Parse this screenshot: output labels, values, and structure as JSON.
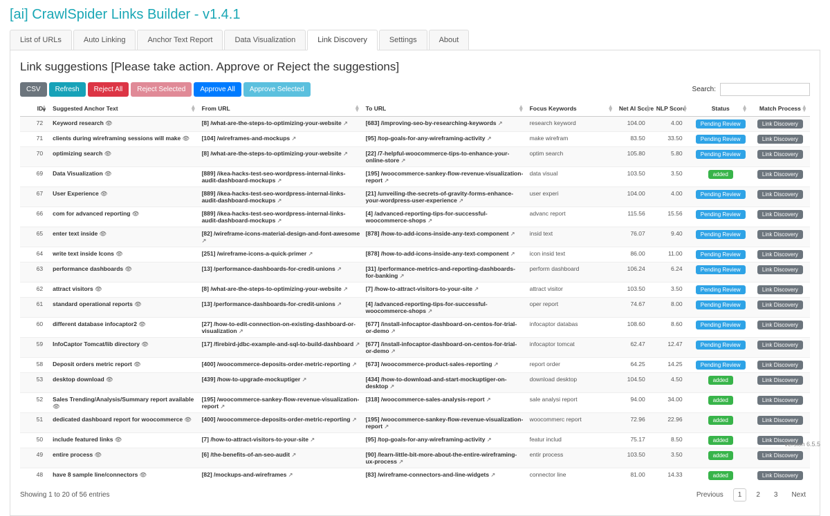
{
  "app_title": "[ai] CrawlSpider Links Builder - v1.4.1",
  "tabs": [
    {
      "label": "List of URLs"
    },
    {
      "label": "Auto Linking"
    },
    {
      "label": "Anchor Text Report"
    },
    {
      "label": "Data Visualization"
    },
    {
      "label": "Link Discovery",
      "active": true
    },
    {
      "label": "Settings"
    },
    {
      "label": "About"
    }
  ],
  "panel": {
    "heading": "Link suggestions [Please take action. Approve or Reject the suggestions]",
    "buttons": {
      "csv": "CSV",
      "refresh": "Refresh",
      "reject_all": "Reject All",
      "reject_selected": "Reject Selected",
      "approve_all": "Approve All",
      "approve_selected": "Approve Selected"
    },
    "search_label": "Search:",
    "columns": {
      "id": "ID",
      "anchor": "Suggested Anchor Text",
      "from": "From URL",
      "to": "To URL",
      "focus": "Focus Keywords",
      "net": "Net AI Score",
      "nlp": "NLP Score",
      "status": "Status",
      "match": "Match Process"
    },
    "status_labels": {
      "pending": "Pending Review",
      "added": "added"
    },
    "match_label": "Link Discovery",
    "rows": [
      {
        "id": 72,
        "anchor": "Keyword research",
        "from_n": 8,
        "from": "/what-are-the-steps-to-optimizing-your-website",
        "to_n": 683,
        "to": "/improving-seo-by-researching-keywords",
        "kw": "research keyword",
        "net": "104.00",
        "nlp": "4.00",
        "status": "pending"
      },
      {
        "id": 71,
        "anchor": "clients during wireframing sessions will make",
        "from_n": 104,
        "from": "/wireframes-and-mockups",
        "to_n": 95,
        "to": "/top-goals-for-any-wireframing-activity",
        "kw": "make wirefram",
        "net": "83.50",
        "nlp": "33.50",
        "status": "pending"
      },
      {
        "id": 70,
        "anchor": "optimizing search",
        "from_n": 8,
        "from": "/what-are-the-steps-to-optimizing-your-website",
        "to_n": 22,
        "to": "/7-helpful-woocommerce-tips-to-enhance-your-online-store",
        "kw": "optim search",
        "net": "105.80",
        "nlp": "5.80",
        "status": "pending"
      },
      {
        "id": 69,
        "anchor": "Data Visualization",
        "from_n": 889,
        "from": "/ikea-hacks-test-seo-wordpress-internal-links-audit-dashboard-mockups",
        "to_n": 195,
        "to": "/woocommerce-sankey-flow-revenue-visualization-report",
        "kw": "data visual",
        "net": "103.50",
        "nlp": "3.50",
        "status": "added"
      },
      {
        "id": 67,
        "anchor": "User Experience",
        "from_n": 889,
        "from": "/ikea-hacks-test-seo-wordpress-internal-links-audit-dashboard-mockups",
        "to_n": 21,
        "to": "/unveiling-the-secrets-of-gravity-forms-enhance-your-wordpress-user-experience",
        "kw": "user experi",
        "net": "104.00",
        "nlp": "4.00",
        "status": "pending"
      },
      {
        "id": 66,
        "anchor": "com for advanced reporting",
        "from_n": 889,
        "from": "/ikea-hacks-test-seo-wordpress-internal-links-audit-dashboard-mockups",
        "to_n": 4,
        "to": "/advanced-reporting-tips-for-successful-woocommerce-shops",
        "kw": "advanc report",
        "net": "115.56",
        "nlp": "15.56",
        "status": "pending"
      },
      {
        "id": 65,
        "anchor": "enter text inside",
        "from_n": 82,
        "from": "/wireframe-icons-material-design-and-font-awesome",
        "to_n": 878,
        "to": "/how-to-add-icons-inside-any-text-component",
        "kw": "insid text",
        "net": "76.07",
        "nlp": "9.40",
        "status": "pending"
      },
      {
        "id": 64,
        "anchor": "write text inside Icons",
        "from_n": 251,
        "from": "/wireframe-icons-a-quick-primer",
        "to_n": 878,
        "to": "/how-to-add-icons-inside-any-text-component",
        "kw": "icon insid text",
        "net": "86.00",
        "nlp": "11.00",
        "status": "pending"
      },
      {
        "id": 63,
        "anchor": "performance dashboards",
        "from_n": 13,
        "from": "/performance-dashboards-for-credit-unions",
        "to_n": 31,
        "to": "/performance-metrics-and-reporting-dashboards-for-banking",
        "kw": "perform dashboard",
        "net": "106.24",
        "nlp": "6.24",
        "status": "pending"
      },
      {
        "id": 62,
        "anchor": "attract visitors",
        "from_n": 8,
        "from": "/what-are-the-steps-to-optimizing-your-website",
        "to_n": 7,
        "to": "/how-to-attract-visitors-to-your-site",
        "kw": "attract visitor",
        "net": "103.50",
        "nlp": "3.50",
        "status": "pending"
      },
      {
        "id": 61,
        "anchor": "standard operational reports",
        "from_n": 13,
        "from": "/performance-dashboards-for-credit-unions",
        "to_n": 4,
        "to": "/advanced-reporting-tips-for-successful-woocommerce-shops",
        "kw": "oper report",
        "net": "74.67",
        "nlp": "8.00",
        "status": "pending"
      },
      {
        "id": 60,
        "anchor": "different database infocaptor2",
        "from_n": 27,
        "from": "/how-to-edit-connection-on-existing-dashboard-or-visualization",
        "to_n": 677,
        "to": "/install-infocaptor-dashboard-on-centos-for-trial-or-demo",
        "kw": "infocaptor databas",
        "net": "108.60",
        "nlp": "8.60",
        "status": "pending"
      },
      {
        "id": 59,
        "anchor": "InfoCaptor Tomcat/lib directory",
        "from_n": 17,
        "from": "/firebird-jdbc-example-and-sql-to-build-dashboard",
        "to_n": 677,
        "to": "/install-infocaptor-dashboard-on-centos-for-trial-or-demo",
        "kw": "infocaptor tomcat",
        "net": "62.47",
        "nlp": "12.47",
        "status": "pending"
      },
      {
        "id": 58,
        "anchor": "Deposit orders metric report",
        "from_n": 400,
        "from": "/woocommerce-deposits-order-metric-reporting",
        "to_n": 673,
        "to": "/woocommerce-product-sales-reporting",
        "kw": "report order",
        "net": "64.25",
        "nlp": "14.25",
        "status": "pending"
      },
      {
        "id": 53,
        "anchor": "desktop download",
        "from_n": 439,
        "from": "/how-to-upgrade-mockuptiger",
        "to_n": 434,
        "to": "/how-to-download-and-start-mockuptiger-on-desktop",
        "kw": "download desktop",
        "net": "104.50",
        "nlp": "4.50",
        "status": "added"
      },
      {
        "id": 52,
        "anchor": "Sales Trending/Analysis/Summary report available",
        "from_n": 195,
        "from": "/woocommerce-sankey-flow-revenue-visualization-report",
        "to_n": 318,
        "to": "/woocommerce-sales-analysis-report",
        "kw": "sale analysi report",
        "net": "94.00",
        "nlp": "34.00",
        "status": "added"
      },
      {
        "id": 51,
        "anchor": "dedicated dashboard report for woocommerce",
        "from_n": 400,
        "from": "/woocommerce-deposits-order-metric-reporting",
        "to_n": 195,
        "to": "/woocommerce-sankey-flow-revenue-visualization-report",
        "kw": "woocommerc report",
        "net": "72.96",
        "nlp": "22.96",
        "status": "added"
      },
      {
        "id": 50,
        "anchor": "include featured links",
        "from_n": 7,
        "from": "/how-to-attract-visitors-to-your-site",
        "to_n": 95,
        "to": "/top-goals-for-any-wireframing-activity",
        "kw": "featur includ",
        "net": "75.17",
        "nlp": "8.50",
        "status": "added"
      },
      {
        "id": 49,
        "anchor": "entire process",
        "from_n": 6,
        "from": "/the-benefits-of-an-seo-audit",
        "to_n": 90,
        "to": "/learn-little-bit-more-about-the-entire-wireframing-ux-process",
        "kw": "entir process",
        "net": "103.50",
        "nlp": "3.50",
        "status": "added"
      },
      {
        "id": 48,
        "anchor": "have 8 sample line/connectors",
        "from_n": 82,
        "from": "/mockups-and-wireframes",
        "to_n": 83,
        "to": "/wireframe-connectors-and-line-widgets",
        "kw": "connector line",
        "net": "81.00",
        "nlp": "14.33",
        "status": "added"
      }
    ],
    "footer_info": "Showing 1 to 20 of 56 entries",
    "pager": {
      "prev": "Previous",
      "pages": [
        "1",
        "2",
        "3"
      ],
      "next": "Next",
      "current": "1"
    }
  },
  "version": "Version 6.5.5"
}
